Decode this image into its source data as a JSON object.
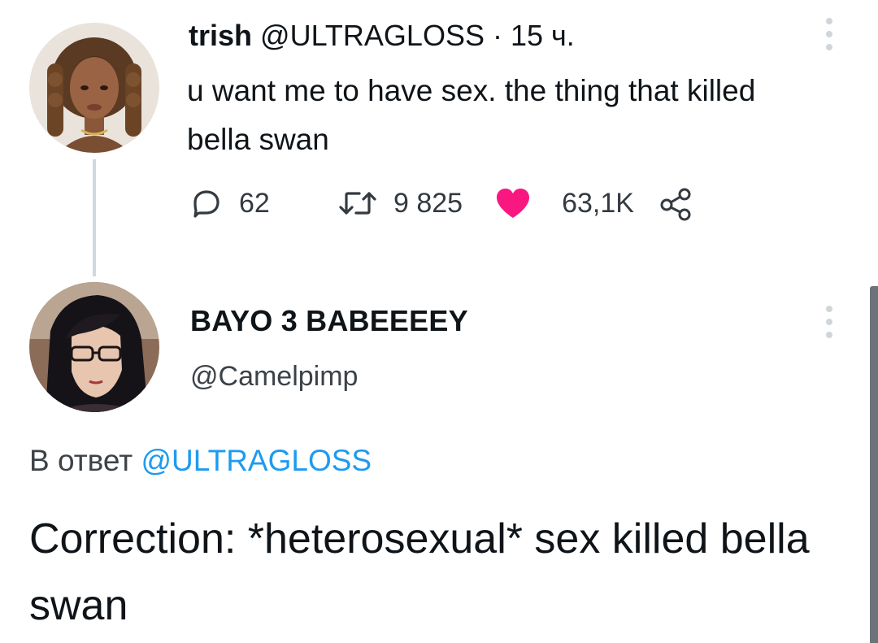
{
  "tweet1": {
    "name": "trish",
    "handle": "@ULTRAGLOSS",
    "separator": " · ",
    "time": "15 ч.",
    "text": "u want me to have sex. the thing that killed bella swan",
    "replies": "62",
    "retweets": "9 825",
    "likes": "63,1K",
    "icons": {
      "avatar": "avatar-woman-braids",
      "reply": "speech-bubble-icon",
      "retweet": "retweet-arrows-icon",
      "like": "heart-filled-icon",
      "share": "share-nodes-icon",
      "more": "vertical-dots-icon"
    }
  },
  "tweet2": {
    "name": "BAYO 3 BABEEEEY",
    "handle": "@Camelpimp",
    "reply_prefix": "В ответ",
    "reply_mention": "@ULTRAGLOSS",
    "text": "Correction: *heterosexual* sex killed bella swan",
    "icons": {
      "avatar": "avatar-bayonetta-glasses",
      "more": "vertical-dots-icon"
    }
  },
  "colors": {
    "text": "#0f1419",
    "secondary": "#3b4248",
    "like": "#f91880",
    "mention": "#1d9bf0",
    "thread_line": "#cfd9de"
  }
}
